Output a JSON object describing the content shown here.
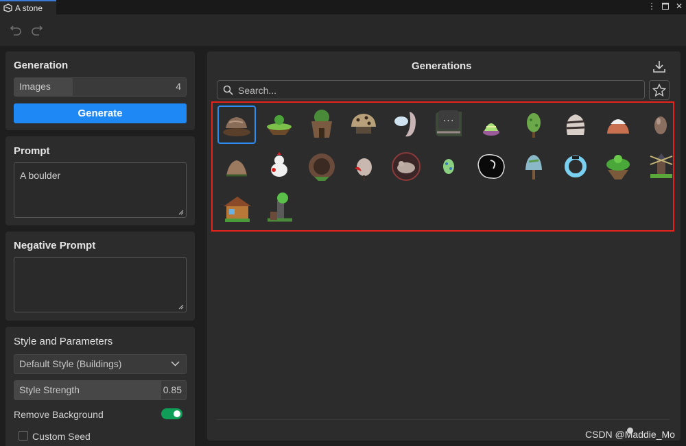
{
  "window": {
    "tab_title": "A stone"
  },
  "generation": {
    "title": "Generation",
    "images_label": "Images",
    "images_value": "4",
    "generate_label": "Generate"
  },
  "prompt": {
    "title": "Prompt",
    "value": "A boulder"
  },
  "negative_prompt": {
    "title": "Negative Prompt",
    "value": ""
  },
  "style": {
    "title": "Style and Parameters",
    "selected_style": "Default Style (Buildings)",
    "strength_label": "Style Strength",
    "strength_value": "0.85",
    "remove_bg_label": "Remove Background",
    "remove_bg_on": true,
    "custom_seed_label": "Custom Seed",
    "custom_seed_checked": false
  },
  "generations": {
    "title": "Generations",
    "search_placeholder": "Search...",
    "more_label": "···",
    "items": [
      {
        "name": "boulder-on-mat",
        "selected": true
      },
      {
        "name": "floating-island"
      },
      {
        "name": "stone-tree-house"
      },
      {
        "name": "speckled-mushroom-rock"
      },
      {
        "name": "pale-rock-arch"
      },
      {
        "name": "dark-stone-block"
      },
      {
        "name": "pink-crystal-blob"
      },
      {
        "name": "green-tree"
      },
      {
        "name": "striped-stone"
      },
      {
        "name": "snow-capped-rock"
      },
      {
        "name": "brown-egg"
      },
      {
        "name": "small-boulder"
      },
      {
        "name": "red-bird"
      },
      {
        "name": "stone-cave-entrance"
      },
      {
        "name": "red-creature"
      },
      {
        "name": "rock-creature-circle"
      },
      {
        "name": "green-egg"
      },
      {
        "name": "black-blob"
      },
      {
        "name": "blue-tree"
      },
      {
        "name": "blue-ring"
      },
      {
        "name": "green-island"
      },
      {
        "name": "windmill"
      },
      {
        "name": "wooden-house"
      },
      {
        "name": "tree-tower"
      }
    ]
  },
  "watermark": "CSDN @Maddie_Mo"
}
